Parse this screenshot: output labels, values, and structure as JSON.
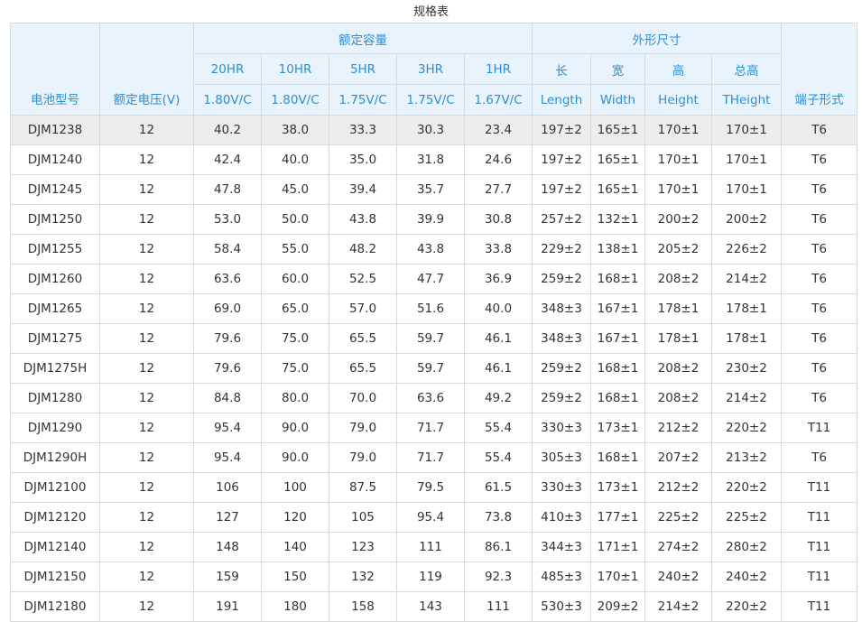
{
  "caption": "规格表",
  "header": {
    "model": "电池型号",
    "voltage": "额定电压(V)",
    "capacity_group": "额定容量",
    "dimension_group": "外形尺寸",
    "terminal": "端子形式",
    "rates": [
      {
        "hr": "20HR",
        "cutoff": "1.80V/C"
      },
      {
        "hr": "10HR",
        "cutoff": "1.80V/C"
      },
      {
        "hr": "5HR",
        "cutoff": "1.75V/C"
      },
      {
        "hr": "3HR",
        "cutoff": "1.75V/C"
      },
      {
        "hr": "1HR",
        "cutoff": "1.67V/C"
      }
    ],
    "dims": [
      {
        "cn": "长",
        "en": "Length"
      },
      {
        "cn": "宽",
        "en": "Width"
      },
      {
        "cn": "高",
        "en": "Height"
      },
      {
        "cn": "总高",
        "en": "THeight"
      }
    ]
  },
  "rows": [
    [
      "DJM1238",
      "12",
      "40.2",
      "38.0",
      "33.3",
      "30.3",
      "23.4",
      "197±2",
      "165±1",
      "170±1",
      "170±1",
      "T6"
    ],
    [
      "DJM1240",
      "12",
      "42.4",
      "40.0",
      "35.0",
      "31.8",
      "24.6",
      "197±2",
      "165±1",
      "170±1",
      "170±1",
      "T6"
    ],
    [
      "DJM1245",
      "12",
      "47.8",
      "45.0",
      "39.4",
      "35.7",
      "27.7",
      "197±2",
      "165±1",
      "170±1",
      "170±1",
      "T6"
    ],
    [
      "DJM1250",
      "12",
      "53.0",
      "50.0",
      "43.8",
      "39.9",
      "30.8",
      "257±2",
      "132±1",
      "200±2",
      "200±2",
      "T6"
    ],
    [
      "DJM1255",
      "12",
      "58.4",
      "55.0",
      "48.2",
      "43.8",
      "33.8",
      "229±2",
      "138±1",
      "205±2",
      "226±2",
      "T6"
    ],
    [
      "DJM1260",
      "12",
      "63.6",
      "60.0",
      "52.5",
      "47.7",
      "36.9",
      "259±2",
      "168±1",
      "208±2",
      "214±2",
      "T6"
    ],
    [
      "DJM1265",
      "12",
      "69.0",
      "65.0",
      "57.0",
      "51.6",
      "40.0",
      "348±3",
      "167±1",
      "178±1",
      "178±1",
      "T6"
    ],
    [
      "DJM1275",
      "12",
      "79.6",
      "75.0",
      "65.5",
      "59.7",
      "46.1",
      "348±3",
      "167±1",
      "178±1",
      "178±1",
      "T6"
    ],
    [
      "DJM1275H",
      "12",
      "79.6",
      "75.0",
      "65.5",
      "59.7",
      "46.1",
      "259±2",
      "168±1",
      "208±2",
      "230±2",
      "T6"
    ],
    [
      "DJM1280",
      "12",
      "84.8",
      "80.0",
      "70.0",
      "63.6",
      "49.2",
      "259±2",
      "168±1",
      "208±2",
      "214±2",
      "T6"
    ],
    [
      "DJM1290",
      "12",
      "95.4",
      "90.0",
      "79.0",
      "71.7",
      "55.4",
      "330±3",
      "173±1",
      "212±2",
      "220±2",
      "T11"
    ],
    [
      "DJM1290H",
      "12",
      "95.4",
      "90.0",
      "79.0",
      "71.7",
      "55.4",
      "305±3",
      "168±1",
      "207±2",
      "213±2",
      "T6"
    ],
    [
      "DJM12100",
      "12",
      "106",
      "100",
      "87.5",
      "79.5",
      "61.5",
      "330±3",
      "173±1",
      "212±2",
      "220±2",
      "T11"
    ],
    [
      "DJM12120",
      "12",
      "127",
      "120",
      "105",
      "95.4",
      "73.8",
      "410±3",
      "177±1",
      "225±2",
      "225±2",
      "T11"
    ],
    [
      "DJM12140",
      "12",
      "148",
      "140",
      "123",
      "111",
      "86.1",
      "344±3",
      "171±1",
      "274±2",
      "280±2",
      "T11"
    ],
    [
      "DJM12150",
      "12",
      "159",
      "150",
      "132",
      "119",
      "92.3",
      "485±3",
      "170±1",
      "240±2",
      "240±2",
      "T11"
    ],
    [
      "DJM12180",
      "12",
      "191",
      "180",
      "158",
      "143",
      "111",
      "530±3",
      "209±2",
      "214±2",
      "220±2",
      "T11"
    ]
  ],
  "highlight_row_index": 0,
  "colors": {
    "header_bg": "#e8f3fb",
    "header_text": "#2e8fd0",
    "border": "#d9d9d9",
    "highlight_bg": "#ececec",
    "cell_text": "#333333"
  }
}
